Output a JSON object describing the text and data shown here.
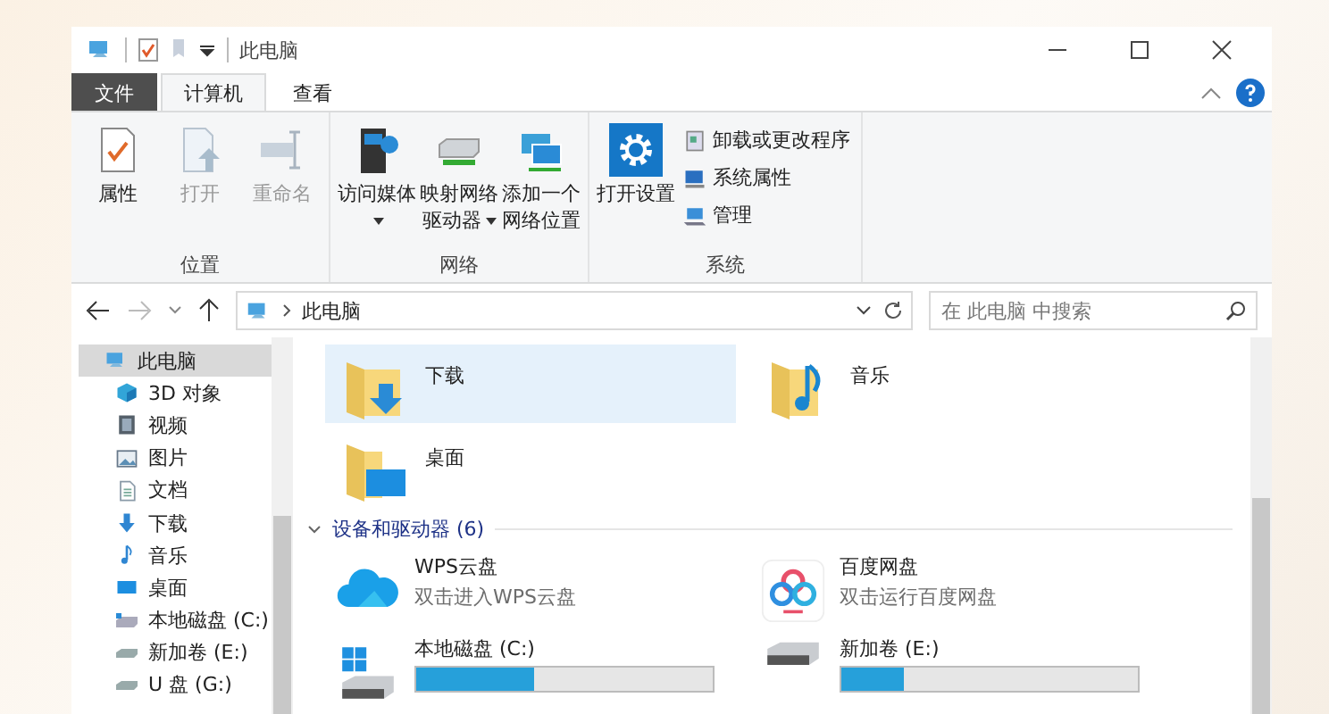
{
  "window": {
    "title": "此电脑"
  },
  "tabs": [
    {
      "label": "文件",
      "kind": "file",
      "selected": false
    },
    {
      "label": "计算机",
      "kind": "tab",
      "selected": true
    },
    {
      "label": "查看",
      "kind": "tab",
      "selected": false
    }
  ],
  "ribbon": {
    "groups": [
      {
        "label": "位置",
        "buttons": [
          {
            "label": "属性",
            "disabled": false,
            "dropdown": false
          },
          {
            "label": "打开",
            "disabled": true,
            "dropdown": false
          },
          {
            "label": "重命名",
            "disabled": true,
            "dropdown": false
          }
        ]
      },
      {
        "label": "网络",
        "buttons": [
          {
            "label": "访问媒体",
            "disabled": false,
            "dropdown": true
          },
          {
            "label": "映射网络驱动器",
            "disabled": false,
            "dropdown": true
          },
          {
            "label": "添加一个网络位置",
            "disabled": false,
            "dropdown": false
          }
        ]
      },
      {
        "label": "系统",
        "buttons": [
          {
            "label": "打开设置",
            "disabled": false,
            "dropdown": false
          }
        ],
        "small_buttons": [
          {
            "label": "卸载或更改程序"
          },
          {
            "label": "系统属性"
          },
          {
            "label": "管理"
          }
        ]
      }
    ]
  },
  "address": {
    "location": "此电脑",
    "search_placeholder": "在 此电脑 中搜索"
  },
  "navigation": [
    {
      "label": "此电脑",
      "selected": true,
      "children": [
        {
          "label": "3D 对象",
          "selected": false
        },
        {
          "label": "视频",
          "selected": false
        },
        {
          "label": "图片",
          "selected": false
        },
        {
          "label": "文档",
          "selected": false
        },
        {
          "label": "下载",
          "selected": false
        },
        {
          "label": "音乐",
          "selected": false
        },
        {
          "label": "桌面",
          "selected": false
        },
        {
          "label": "本地磁盘 (C:)",
          "selected": false
        },
        {
          "label": "新加卷 (E:)",
          "selected": false
        },
        {
          "label": "U 盘 (G:)",
          "selected": false
        }
      ]
    }
  ],
  "folders": [
    {
      "label": "下载",
      "selected": true
    },
    {
      "label": "音乐",
      "selected": false
    },
    {
      "label": "桌面",
      "selected": false
    }
  ],
  "devices": {
    "title": "设备和驱动器 (6)",
    "expanded": true,
    "items": [
      {
        "kind": "app",
        "name": "WPS云盘",
        "subtitle": "双击进入WPS云盘"
      },
      {
        "kind": "app",
        "name": "百度网盘",
        "subtitle": "双击运行百度网盘"
      },
      {
        "kind": "drive",
        "name": "本地磁盘 (C:)",
        "level": 0.4
      },
      {
        "kind": "drive",
        "name": "新加卷 (E:)",
        "level": 0.21
      }
    ]
  }
}
